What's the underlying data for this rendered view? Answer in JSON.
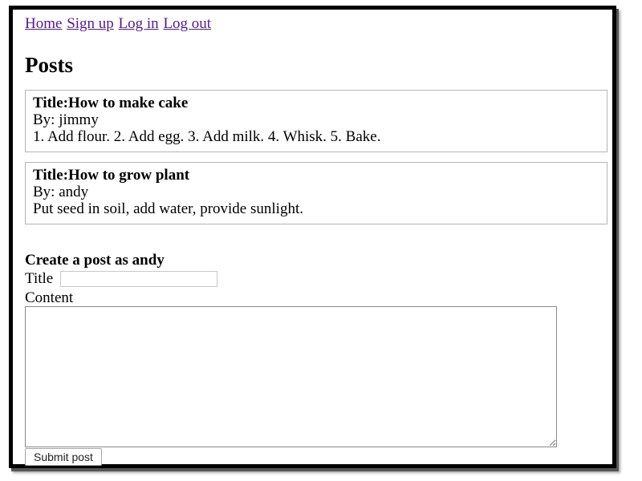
{
  "nav": {
    "links": [
      {
        "label": "Home"
      },
      {
        "label": "Sign up"
      },
      {
        "label": "Log in"
      },
      {
        "label": "Log out"
      }
    ]
  },
  "page": {
    "title": "Posts"
  },
  "posts": [
    {
      "title": "Title:How to make cake",
      "author": "By: jimmy",
      "content": "1. Add flour. 2. Add egg. 3. Add milk. 4. Whisk. 5. Bake."
    },
    {
      "title": "Title:How to grow plant",
      "author": "By: andy",
      "content": "Put seed in soil, add water, provide sunlight."
    }
  ],
  "create_form": {
    "heading": "Create a post as andy",
    "title_label": "Title",
    "title_value": "",
    "content_label": "Content",
    "content_value": "",
    "submit_label": "Submit post"
  },
  "colors": {
    "visited_link": "#551a8b",
    "post_border": "#b5b5b5"
  }
}
